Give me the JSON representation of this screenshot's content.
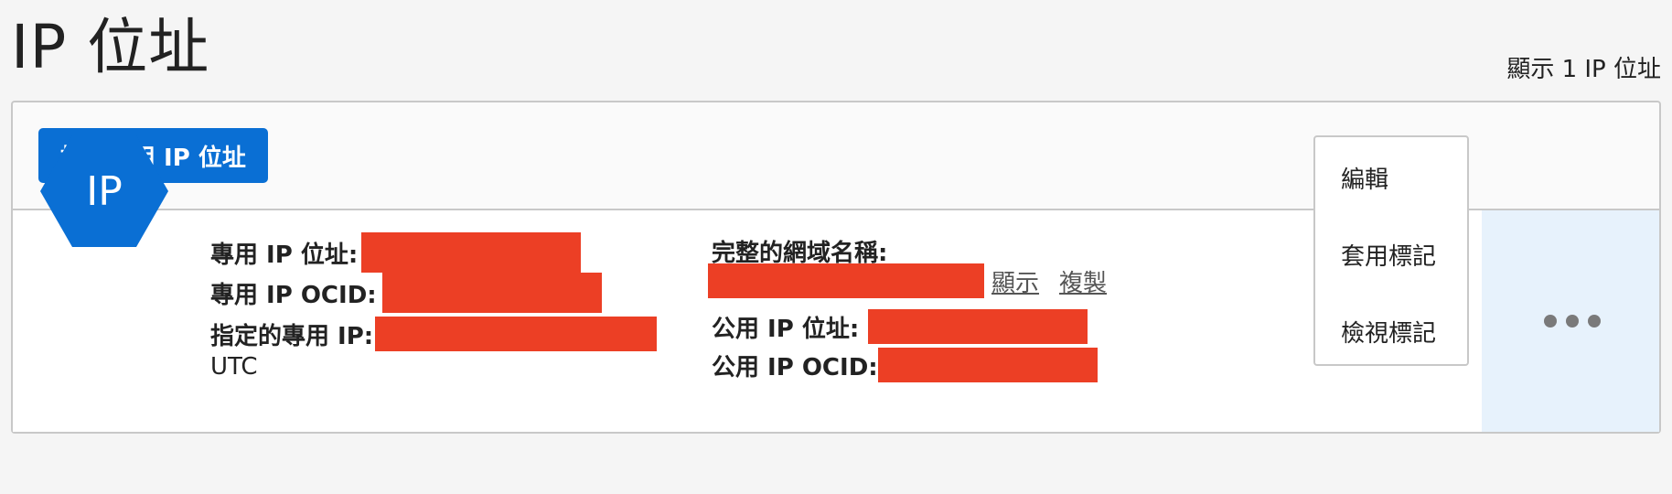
{
  "header": {
    "title": "IP 位址",
    "count_text": "顯示 1 IP 位址"
  },
  "toolbar": {
    "assign_button_label": "指定專用 IP 位址"
  },
  "row": {
    "icon_label": "IP",
    "fields": {
      "private_ip_label": "專用 IP 位址:",
      "private_ocid_label": "專用 IP OCID:",
      "assigned_private_ip_label": "指定的專用 IP:",
      "timezone_text": "UTC",
      "fqdn_label": "完整的網域名稱:",
      "show_link": "顯示",
      "copy_link": "複製",
      "public_ip_label": "公用 IP 位址:",
      "public_ocid_label": "公用 IP OCID:"
    }
  },
  "menu": {
    "items": [
      "編輯",
      "套用標記",
      "檢視標記"
    ]
  },
  "colors": {
    "accent": "#0a6fd4",
    "redaction": "#ec3f25",
    "actions_cell_bg": "#e7f2fc"
  },
  "icons": {
    "actions": "ellipsis-icon",
    "resource": "ip-hexagon-icon"
  }
}
